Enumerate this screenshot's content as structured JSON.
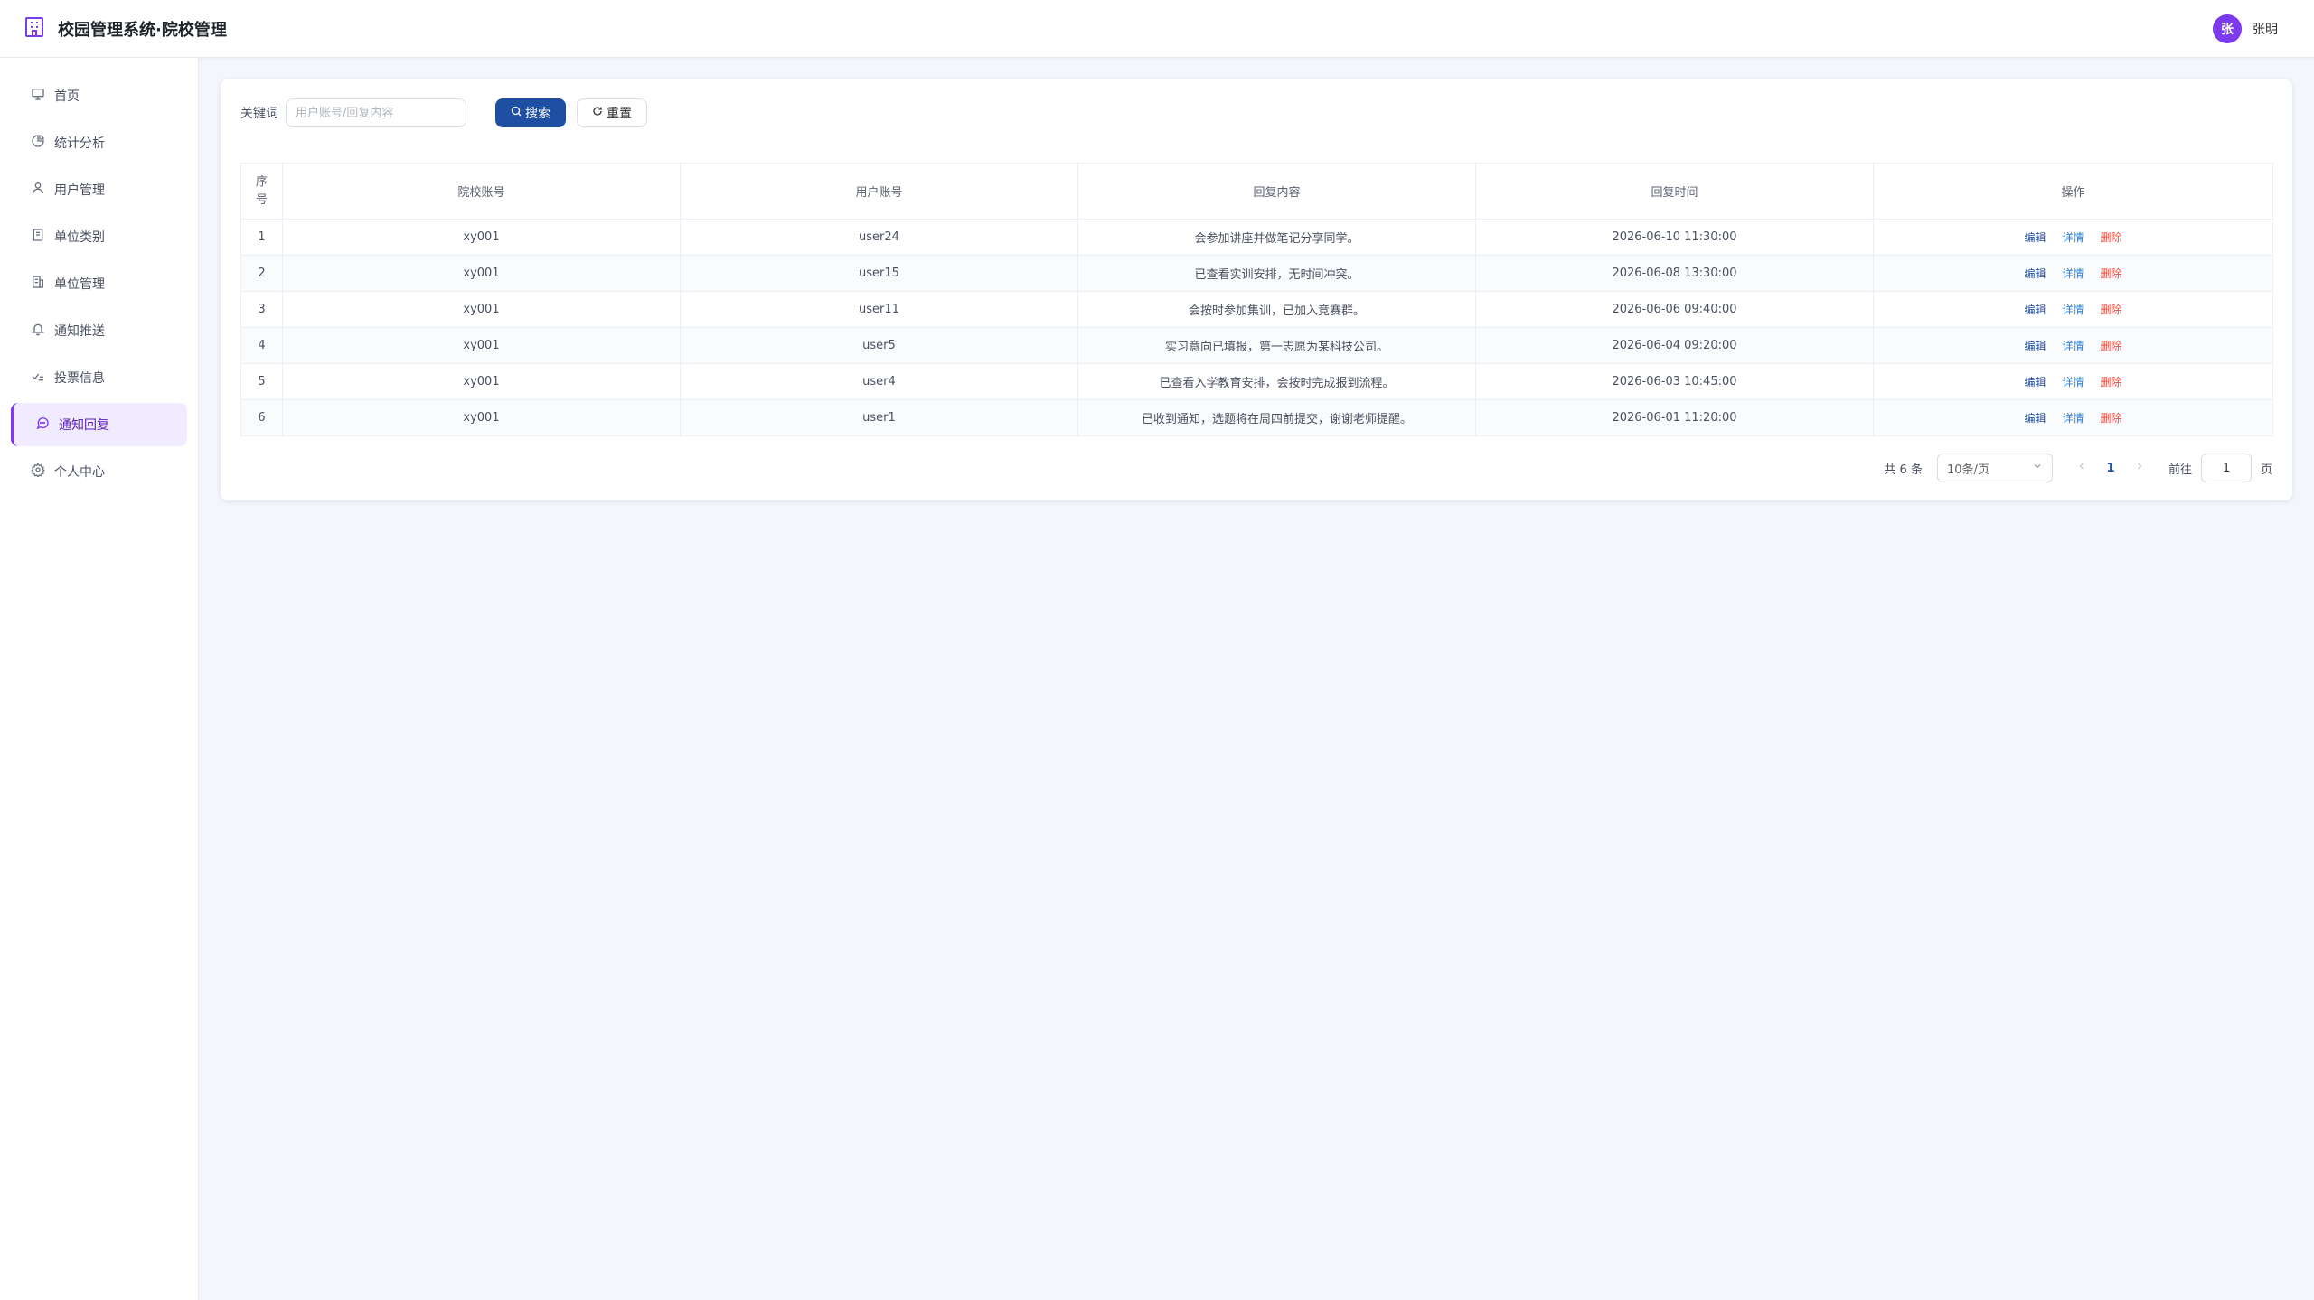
{
  "header": {
    "title": "校园管理系统·院校管理",
    "user_avatar": "张",
    "user_name": "张明",
    "accent": "#7c3aed"
  },
  "sidebar": {
    "items": [
      {
        "label": "首页",
        "icon": "home-icon"
      },
      {
        "label": "统计分析",
        "icon": "pie-chart-icon"
      },
      {
        "label": "用户管理",
        "icon": "user-icon"
      },
      {
        "label": "单位类别",
        "icon": "category-icon"
      },
      {
        "label": "单位管理",
        "icon": "building-icon"
      },
      {
        "label": "通知推送",
        "icon": "bell-icon"
      },
      {
        "label": "投票信息",
        "icon": "vote-icon"
      },
      {
        "label": "通知回复",
        "icon": "chat-icon"
      },
      {
        "label": "个人中心",
        "icon": "gear-icon"
      }
    ],
    "active_index": 7
  },
  "search": {
    "label": "关键词",
    "placeholder": "用户账号/回复内容",
    "value": "",
    "search_label": "搜索",
    "reset_label": "重置"
  },
  "table": {
    "headers": [
      "序号",
      "院校账号",
      "用户账号",
      "回复内容",
      "回复时间",
      "操作"
    ],
    "rows": [
      {
        "index": "1",
        "school": "xy001",
        "user": "user24",
        "content": "会参加讲座并做笔记分享同学。",
        "time": "2026-06-10 11:30:00"
      },
      {
        "index": "2",
        "school": "xy001",
        "user": "user15",
        "content": "已查看实训安排，无时间冲突。",
        "time": "2026-06-08 13:30:00"
      },
      {
        "index": "3",
        "school": "xy001",
        "user": "user11",
        "content": "会按时参加集训，已加入竞赛群。",
        "time": "2026-06-06 09:40:00"
      },
      {
        "index": "4",
        "school": "xy001",
        "user": "user5",
        "content": "实习意向已填报，第一志愿为某科技公司。",
        "time": "2026-06-04 09:20:00"
      },
      {
        "index": "5",
        "school": "xy001",
        "user": "user4",
        "content": "已查看入学教育安排，会按时完成报到流程。",
        "time": "2026-06-03 10:45:00"
      },
      {
        "index": "6",
        "school": "xy001",
        "user": "user1",
        "content": "已收到通知，选题将在周四前提交，谢谢老师提醒。",
        "time": "2026-06-01 11:20:00"
      }
    ],
    "actions": {
      "edit": "编辑",
      "detail": "详情",
      "delete": "删除"
    }
  },
  "pagination": {
    "total_text": "共 6 条",
    "page_size": "10条/页",
    "current_page": "1",
    "goto_label": "前往",
    "goto_value": "1",
    "goto_suffix": "页"
  }
}
